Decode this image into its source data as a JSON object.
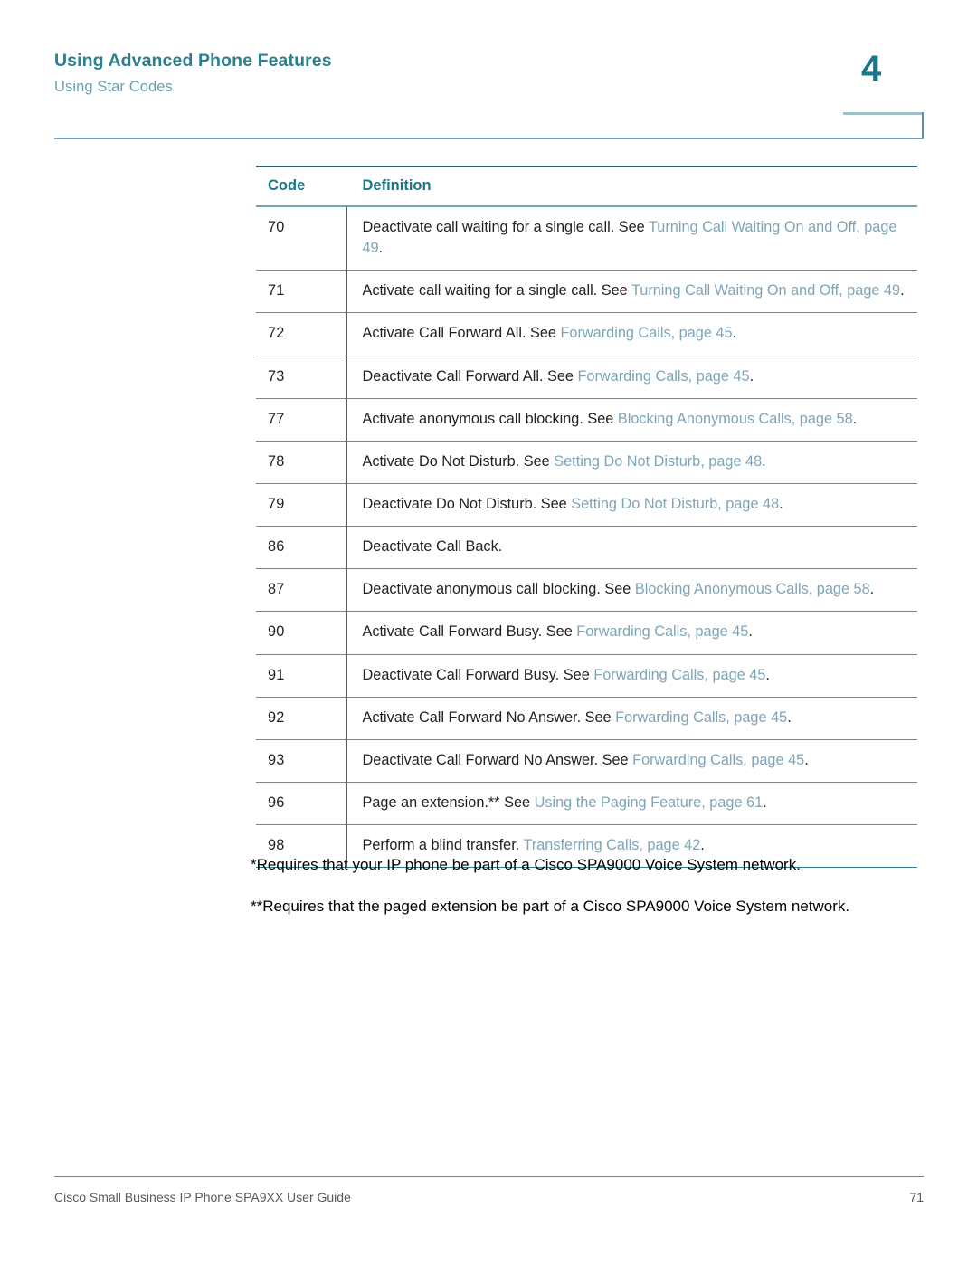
{
  "header": {
    "title": "Using Advanced Phone Features",
    "subtitle": "Using Star Codes",
    "chapter_number": "4",
    "colors": {
      "title": "#2d7f8e",
      "subtitle": "#6f9fb0",
      "chapter": "#17788c",
      "rule": "#6e9fc4",
      "xref_link": "#7ea5b7"
    }
  },
  "table": {
    "columns": [
      "Code",
      "Definition"
    ],
    "rows": [
      {
        "code": "70",
        "definition_plain": "Deactivate call waiting for a single call. See ",
        "xref": "Turning Call Waiting On and Off, page 49",
        "definition_tail": "."
      },
      {
        "code": "71",
        "definition_plain": "Activate call waiting for a single call. See ",
        "xref": "Turning Call Waiting On and Off, page 49",
        "definition_tail": "."
      },
      {
        "code": "72",
        "definition_plain": "Activate Call Forward All. See ",
        "xref": "Forwarding Calls, page 45",
        "definition_tail": "."
      },
      {
        "code": "73",
        "definition_plain": "Deactivate Call Forward All. See ",
        "xref": "Forwarding Calls, page 45",
        "definition_tail": "."
      },
      {
        "code": "77",
        "definition_plain": "Activate anonymous call blocking. See ",
        "xref": "Blocking Anonymous Calls, page 58",
        "definition_tail": "."
      },
      {
        "code": "78",
        "definition_plain": "Activate Do Not Disturb. See ",
        "xref": "Setting Do Not Disturb, page 48",
        "definition_tail": "."
      },
      {
        "code": "79",
        "definition_plain": "Deactivate Do Not Disturb. See ",
        "xref": "Setting Do Not Disturb, page 48",
        "definition_tail": "."
      },
      {
        "code": "86",
        "definition_plain": "Deactivate Call Back.",
        "xref": "",
        "definition_tail": ""
      },
      {
        "code": "87",
        "definition_plain": "Deactivate anonymous call blocking. See ",
        "xref": "Blocking Anonymous Calls, page 58",
        "definition_tail": "."
      },
      {
        "code": "90",
        "definition_plain": "Activate Call Forward Busy. See ",
        "xref": "Forwarding Calls, page 45",
        "definition_tail": "."
      },
      {
        "code": "91",
        "definition_plain": "Deactivate Call Forward Busy. See ",
        "xref": "Forwarding Calls, page 45",
        "definition_tail": "."
      },
      {
        "code": "92",
        "definition_plain": "Activate Call Forward No Answer. See ",
        "xref": "Forwarding Calls, page 45",
        "definition_tail": "."
      },
      {
        "code": "93",
        "definition_plain": "Deactivate Call Forward No Answer. See ",
        "xref": "Forwarding Calls, page 45",
        "definition_tail": "."
      },
      {
        "code": "96",
        "definition_plain": "Page an extension.** See ",
        "xref": "Using the Paging Feature, page 61",
        "definition_tail": "."
      },
      {
        "code": "98",
        "definition_plain": "Perform a blind transfer. ",
        "xref": "Transferring Calls, page 42",
        "definition_tail": "."
      }
    ]
  },
  "footnotes": [
    "*Requires that your IP phone be part of a Cisco SPA9000 Voice System network.",
    "**Requires that the paged extension be part of a Cisco SPA9000 Voice System network."
  ],
  "footer": {
    "guide_title": "Cisco Small Business IP Phone SPA9XX User Guide",
    "page_number": "71"
  }
}
